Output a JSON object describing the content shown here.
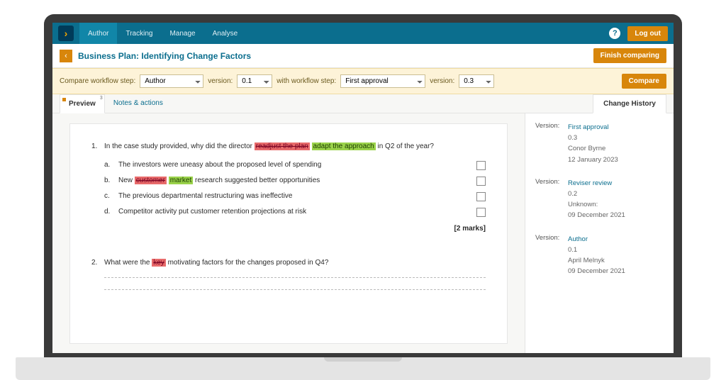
{
  "nav": {
    "tabs": [
      "Author",
      "Tracking",
      "Manage",
      "Analyse"
    ],
    "logout": "Log out"
  },
  "title": {
    "back_glyph": "‹",
    "text": "Business Plan: Identifying Change Factors",
    "finish": "Finish comparing"
  },
  "compare": {
    "label1": "Compare workflow step:",
    "step_a": "Author",
    "label_ver": "version:",
    "ver_a": "0.1",
    "label2": "with workflow step:",
    "step_b": "First approval",
    "ver_b": "0.3",
    "btn": "Compare"
  },
  "tabs": {
    "preview": "Preview",
    "preview_badge": "3",
    "notes": "Notes & actions",
    "history": "Change History"
  },
  "doc": {
    "q1": {
      "num": "1.",
      "pre": "In the case study provided, why did the director ",
      "del1": "readjust the plan",
      "ins1": "adapt the approach",
      "post": " in Q2 of the year?",
      "opts": [
        {
          "l": "a.",
          "t": "The investors were uneasy about the proposed level of spending"
        },
        {
          "l": "b.",
          "pre": "New ",
          "del": "customer",
          "ins": "market",
          "post": " research suggested better opportunities"
        },
        {
          "l": "c.",
          "t": "The previous departmental restructuring was ineffective"
        },
        {
          "l": "d.",
          "t": "Competitor activity put customer retention projections at risk"
        }
      ],
      "marks": "[2 marks]"
    },
    "q2": {
      "num": "2.",
      "pre": "What were the ",
      "del": "key",
      "post": " motivating factors for the changes proposed in Q4?"
    }
  },
  "history": {
    "label": "Version:",
    "items": [
      {
        "step": "First approval",
        "ver": "0.3",
        "user": "Conor Byrne",
        "date": "12 January 2023"
      },
      {
        "step": "Reviser review",
        "ver": "0.2",
        "user": "Unknown:",
        "date": "09 December 2021"
      },
      {
        "step": "Author",
        "ver": "0.1",
        "user": "April Melnyk",
        "date": "09 December 2021"
      }
    ]
  }
}
